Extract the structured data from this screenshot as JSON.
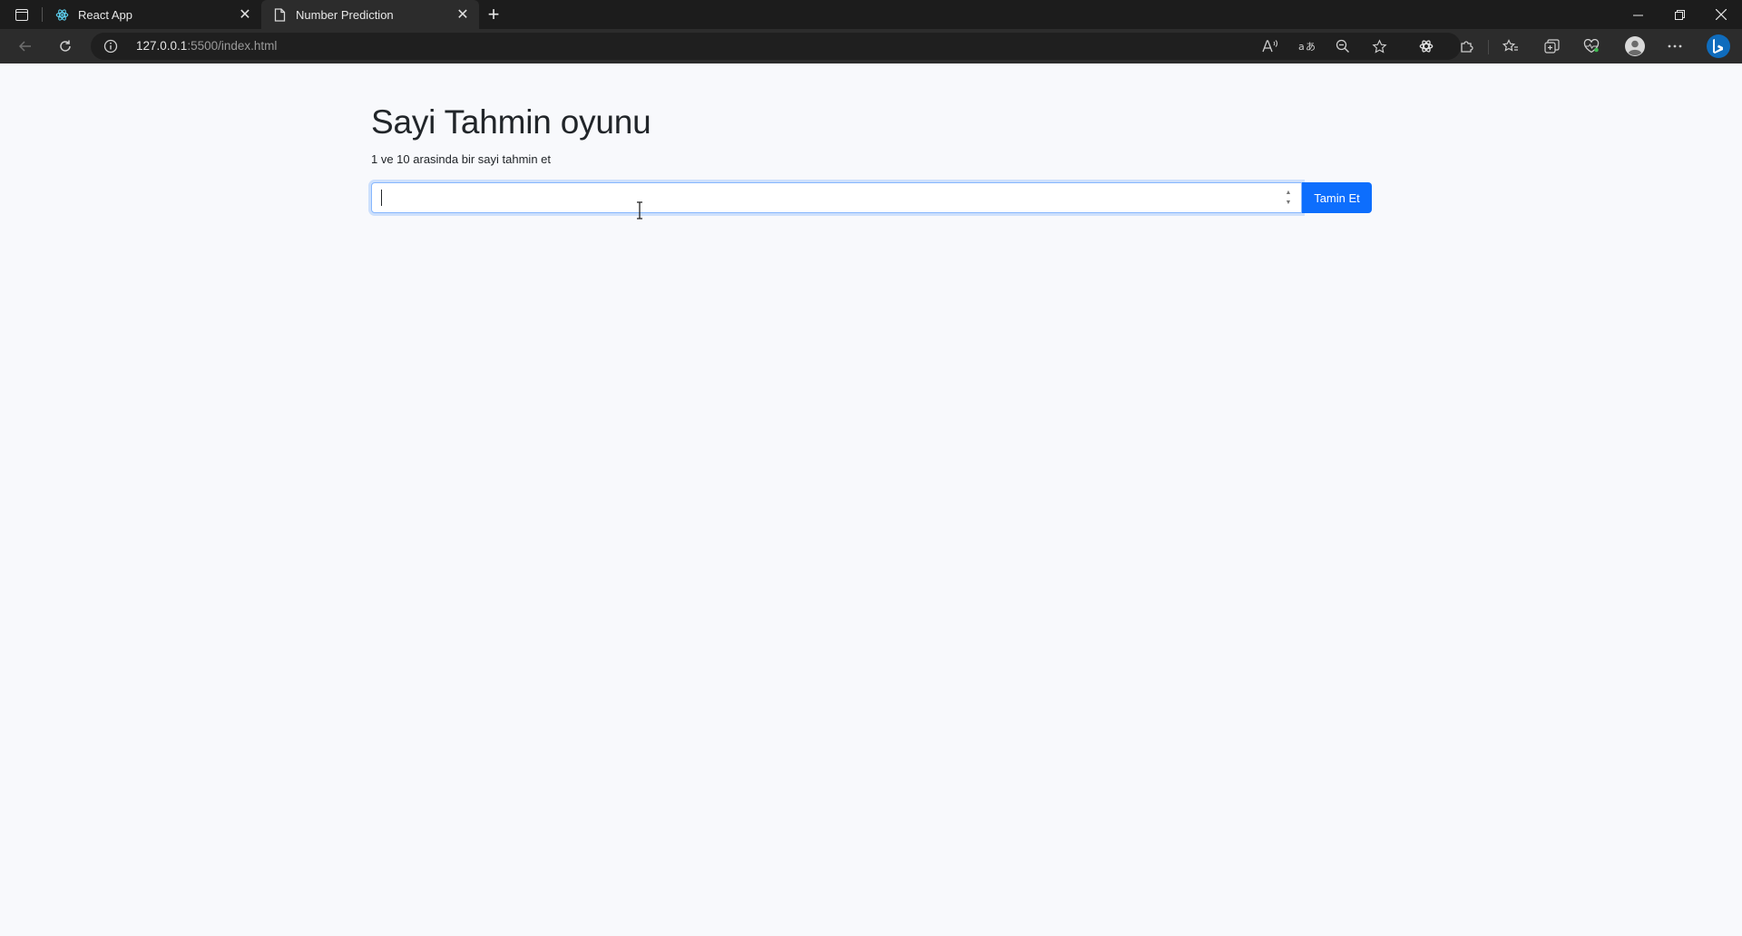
{
  "browser": {
    "tabs": [
      {
        "title": "React App",
        "icon": "react-icon",
        "active": false
      },
      {
        "title": "Number Prediction",
        "icon": "page-icon",
        "active": true
      }
    ],
    "url_host": "127.0.0.1",
    "url_rest": ":5500/index.html",
    "toolbar_icons": [
      "read-aloud-icon",
      "translate-icon",
      "zoom-out-icon",
      "favorite-star-icon",
      "extension-gear-icon",
      "extensions-puzzle-icon",
      "favorites-icon",
      "collections-icon",
      "heart-icon",
      "profile-icon",
      "more-icon",
      "bing-icon"
    ]
  },
  "page": {
    "heading": "Sayi Tahmin oyunu",
    "subtitle": "1 ve 10 arasinda bir sayi tahmin et",
    "guess_input_value": "",
    "guess_button_label": "Tamin Et"
  },
  "colors": {
    "accent": "#0d6efd",
    "page_bg": "#f8f9fc",
    "chrome_bg": "#2c2c2c"
  }
}
